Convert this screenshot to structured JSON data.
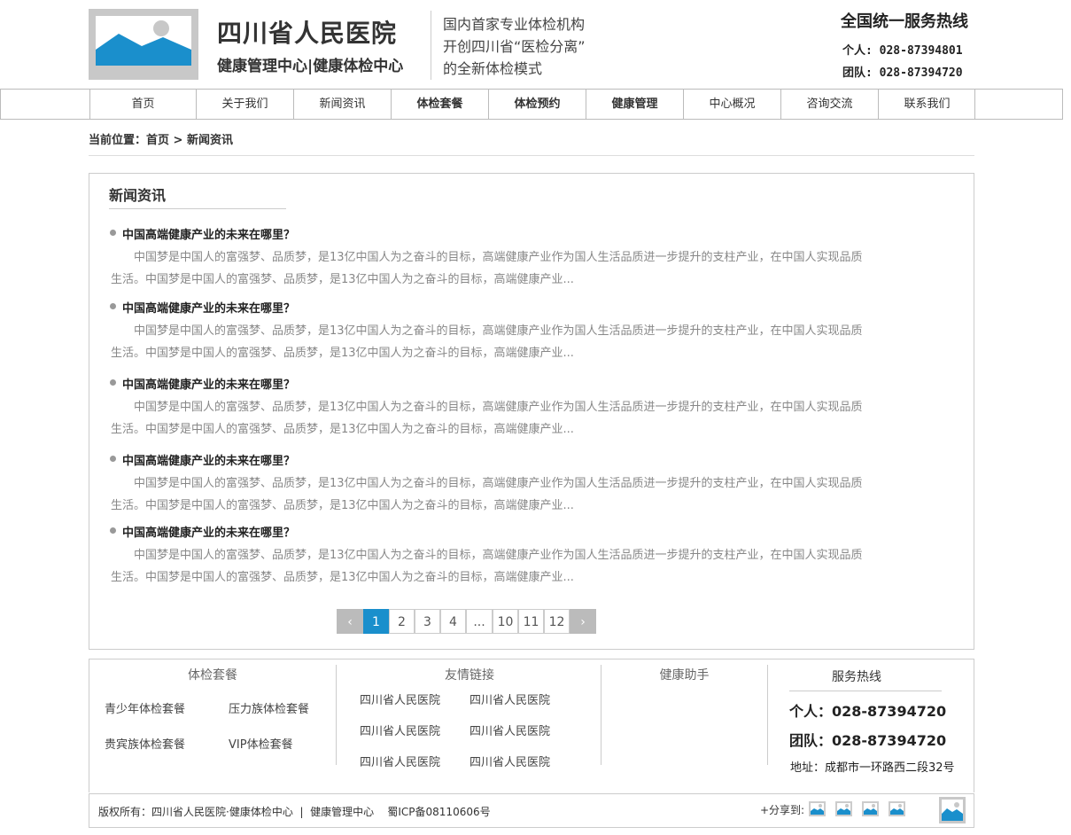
{
  "header": {
    "title": "四川省人民医院",
    "subtitle": "健康管理中心|健康体检中心",
    "slogan": [
      "国内首家专业体检机构",
      "开创四川省“医检分离”",
      "的全新体检模式"
    ],
    "hotline_title": "全国统一服务热线",
    "hotline_personal": "个人: 028-87394801",
    "hotline_team": "团队: 028-87394720"
  },
  "nav": [
    {
      "label": "首页",
      "bold": false
    },
    {
      "label": "关于我们",
      "bold": false
    },
    {
      "label": "新闻资讯",
      "bold": false
    },
    {
      "label": "体检套餐",
      "bold": true
    },
    {
      "label": "体检预约",
      "bold": true
    },
    {
      "label": "健康管理",
      "bold": true
    },
    {
      "label": "中心概况",
      "bold": false
    },
    {
      "label": "咨询交流",
      "bold": false
    },
    {
      "label": "联系我们",
      "bold": false
    }
  ],
  "breadcrumb": "当前位置：首页 > 新闻资讯",
  "section_title": "新闻资讯",
  "news": [
    {
      "title": "中国高端健康产业的未来在哪里？",
      "body": "中国梦是中国人的富强梦、品质梦，是13亿中国人为之奋斗的目标，高端健康产业作为国人生活品质进一步提升的支柱产业，在中国人实现品质生活。中国梦是中国人的富强梦、品质梦，是13亿中国人为之奋斗的目标，高端健康产业..."
    },
    {
      "title": "中国高端健康产业的未来在哪里？",
      "body": "中国梦是中国人的富强梦、品质梦，是13亿中国人为之奋斗的目标，高端健康产业作为国人生活品质进一步提升的支柱产业，在中国人实现品质生活。中国梦是中国人的富强梦、品质梦，是13亿中国人为之奋斗的目标，高端健康产业..."
    },
    {
      "title": "中国高端健康产业的未来在哪里？",
      "body": "中国梦是中国人的富强梦、品质梦，是13亿中国人为之奋斗的目标，高端健康产业作为国人生活品质进一步提升的支柱产业，在中国人实现品质生活。中国梦是中国人的富强梦、品质梦，是13亿中国人为之奋斗的目标，高端健康产业..."
    },
    {
      "title": "中国高端健康产业的未来在哪里？",
      "body": "中国梦是中国人的富强梦、品质梦，是13亿中国人为之奋斗的目标，高端健康产业作为国人生活品质进一步提升的支柱产业，在中国人实现品质生活。中国梦是中国人的富强梦、品质梦，是13亿中国人为之奋斗的目标，高端健康产业..."
    },
    {
      "title": "中国高端健康产业的未来在哪里？",
      "body": "中国梦是中国人的富强梦、品质梦，是13亿中国人为之奋斗的目标，高端健康产业作为国人生活品质进一步提升的支柱产业，在中国人实现品质生活。中国梦是中国人的富强梦、品质梦，是13亿中国人为之奋斗的目标，高端健康产业..."
    }
  ],
  "pagination": {
    "prev": "‹",
    "pages": [
      "1",
      "2",
      "3",
      "4",
      "...",
      "10",
      "11",
      "12"
    ],
    "current": "1",
    "next": "›"
  },
  "footer": {
    "packages_title": "体检套餐",
    "packages": [
      "青少年体检套餐",
      "压力族体检套餐",
      "贵宾族体检套餐",
      "VIP体检套餐"
    ],
    "links_title": "友情链接",
    "links": [
      "四川省人民医院",
      "四川省人民医院",
      "四川省人民医院",
      "四川省人民医院",
      "四川省人民医院",
      "四川省人民医院"
    ],
    "helper_title": "健康助手",
    "service_title": "服务热线",
    "service_personal": "个人：028-87394720",
    "service_team": "团队：028-87394720",
    "address": "地址：成都市一环路西二段32号"
  },
  "copyright": "版权所有：四川省人民医院·健康体检中心  |  健康管理中心    蜀ICP备08110606号",
  "share_label": "+分享到:",
  "colors": {
    "accent": "#1a8fcc",
    "placeholder": "#c8c8c8",
    "image_blue": "#1a8fcc"
  }
}
